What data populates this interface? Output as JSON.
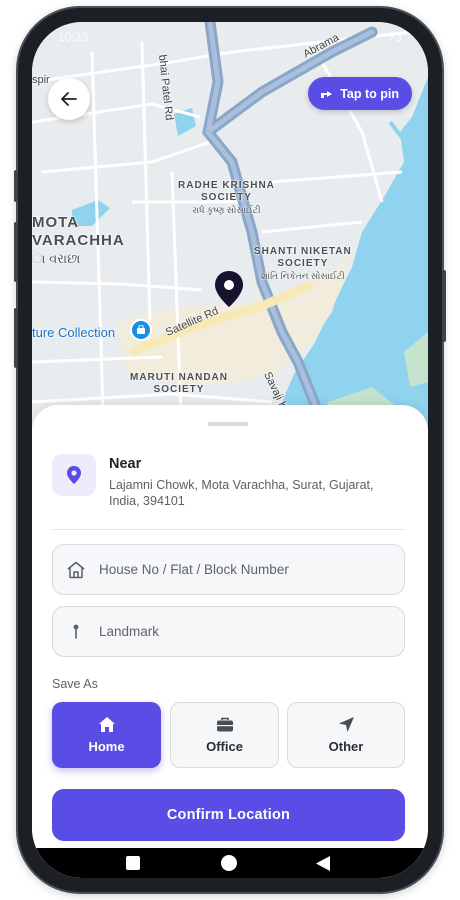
{
  "status_bar": {
    "time": "10:33",
    "battery": "73"
  },
  "map": {
    "place_labels": [
      {
        "name": "Mota Varachha",
        "line1": "MOTA",
        "line2": "VARACHHA",
        "local": "ા વરાછા"
      },
      {
        "name": "Radhe Krishna Society",
        "line1": "RADHE KRISHNA",
        "line2": "SOCIETY",
        "local": "રાધે કૃષ્ણ સોસાઈટી"
      },
      {
        "name": "Shanti Niketan Society",
        "line1": "SHANTI NIKETAN",
        "line2": "SOCIETY",
        "local": "શાંતિ નિકેતન સોસાઈટી"
      },
      {
        "name": "Maruti Nandan Society",
        "line1": "MARUTI NANDAN",
        "line2": "SOCIETY"
      }
    ],
    "road_labels": {
      "road1": "bhai Patel Rd",
      "road2": "Satellite Rd",
      "road3": "Savaji Kor",
      "road4": "Abrama",
      "road5": "spir"
    },
    "poi_label": "ture Collection",
    "tap_to_pin_label": "Tap to pin",
    "back_icon": "arrow-left-icon",
    "water_color": "#8fd3ee",
    "land_color": "#e9ecee",
    "pin_color": "#15132e"
  },
  "sheet": {
    "location_title": "Near",
    "location_address": "Lajamni Chowk, Mota Varachha, Surat, Gujarat, India, 394101",
    "house_field": {
      "placeholder": "House No / Flat / Block Number",
      "value": ""
    },
    "landmark_field": {
      "placeholder": "Landmark",
      "value": ""
    },
    "save_as_label": "Save As",
    "address_types": [
      {
        "label": "Home",
        "icon": "home-icon",
        "selected": true
      },
      {
        "label": "Office",
        "icon": "briefcase-icon",
        "selected": false
      },
      {
        "label": "Other",
        "icon": "navigation-arrow-icon",
        "selected": false
      }
    ],
    "confirm_label": "Confirm Location",
    "accent_color": "#5a4de6"
  },
  "nav_bar": {
    "icons": [
      "square-recents-icon",
      "circle-home-icon",
      "triangle-back-icon"
    ]
  }
}
